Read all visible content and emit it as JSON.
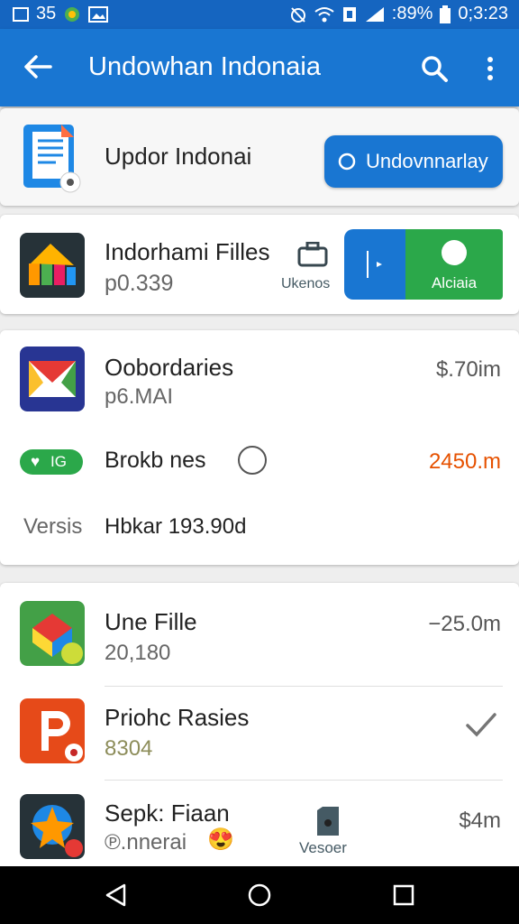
{
  "status_bar": {
    "left_text": "35",
    "battery": ":89%",
    "time": "0;3:23"
  },
  "app_bar": {
    "title": "Undowhan Indonaia",
    "icons": [
      "back-arrow-icon",
      "search-icon",
      "more-vert-icon"
    ]
  },
  "top_item": {
    "name": "Updor Indonai",
    "button_label": "Undovnnarlay"
  },
  "files_card": {
    "name": "Indorhami Filles",
    "size": "p0.339",
    "small_label": "Ukenos",
    "action_label": "Alciaia"
  },
  "group_card": {
    "item": {
      "name": "Oobordaries",
      "size": "p6.MAI",
      "price": "$.70im"
    },
    "badge_text": "IG",
    "badge_row_text": "Brokb nes",
    "badge_row_price": "2450.m",
    "version_label": "Versis",
    "version_value": "Hbkar 193.90d"
  },
  "list": [
    {
      "name": "Une Fille",
      "size": "20,180",
      "price": "−25.0m"
    },
    {
      "name": "Priohc Rasies",
      "size": "8304",
      "trailing_icon": "check-icon"
    },
    {
      "name": "Sepk: Fiaan",
      "size": "℗.nnerai",
      "emoji": "😍",
      "mid_label": "Vesoer",
      "price": "$4m"
    }
  ],
  "colors": {
    "primary": "#1976d2",
    "status_bar": "#1565c0",
    "green_action": "#2ba84a",
    "orange_price": "#e65100"
  }
}
